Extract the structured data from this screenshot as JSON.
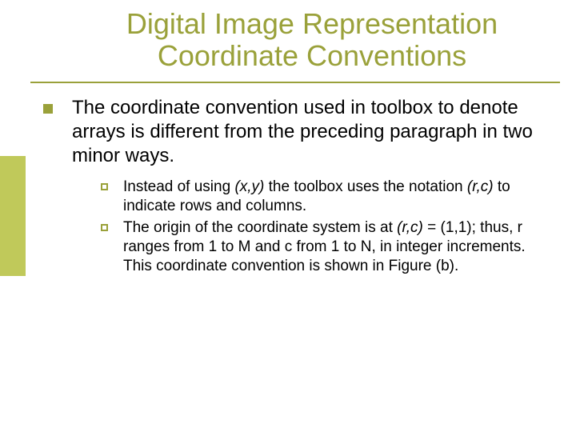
{
  "title_line1": "Digital Image Representation",
  "title_line2": "Coordinate Conventions",
  "main_point": "The coordinate convention used in toolbox to denote arrays is different from the preceding paragraph in two minor ways.",
  "sub1_a": "Instead of using ",
  "sub1_xy": "(x,y)",
  "sub1_b": " the toolbox uses the notation ",
  "sub1_rc": "(r,c)",
  "sub1_c": " to indicate rows and columns.",
  "sub2_a": "The origin of the coordinate system is at ",
  "sub2_rc": "(r,c)",
  "sub2_b": " = (1,1); thus, r ranges from 1 to M and c from 1 to N, in integer increments. This coordinate convention is shown in Figure (b)."
}
